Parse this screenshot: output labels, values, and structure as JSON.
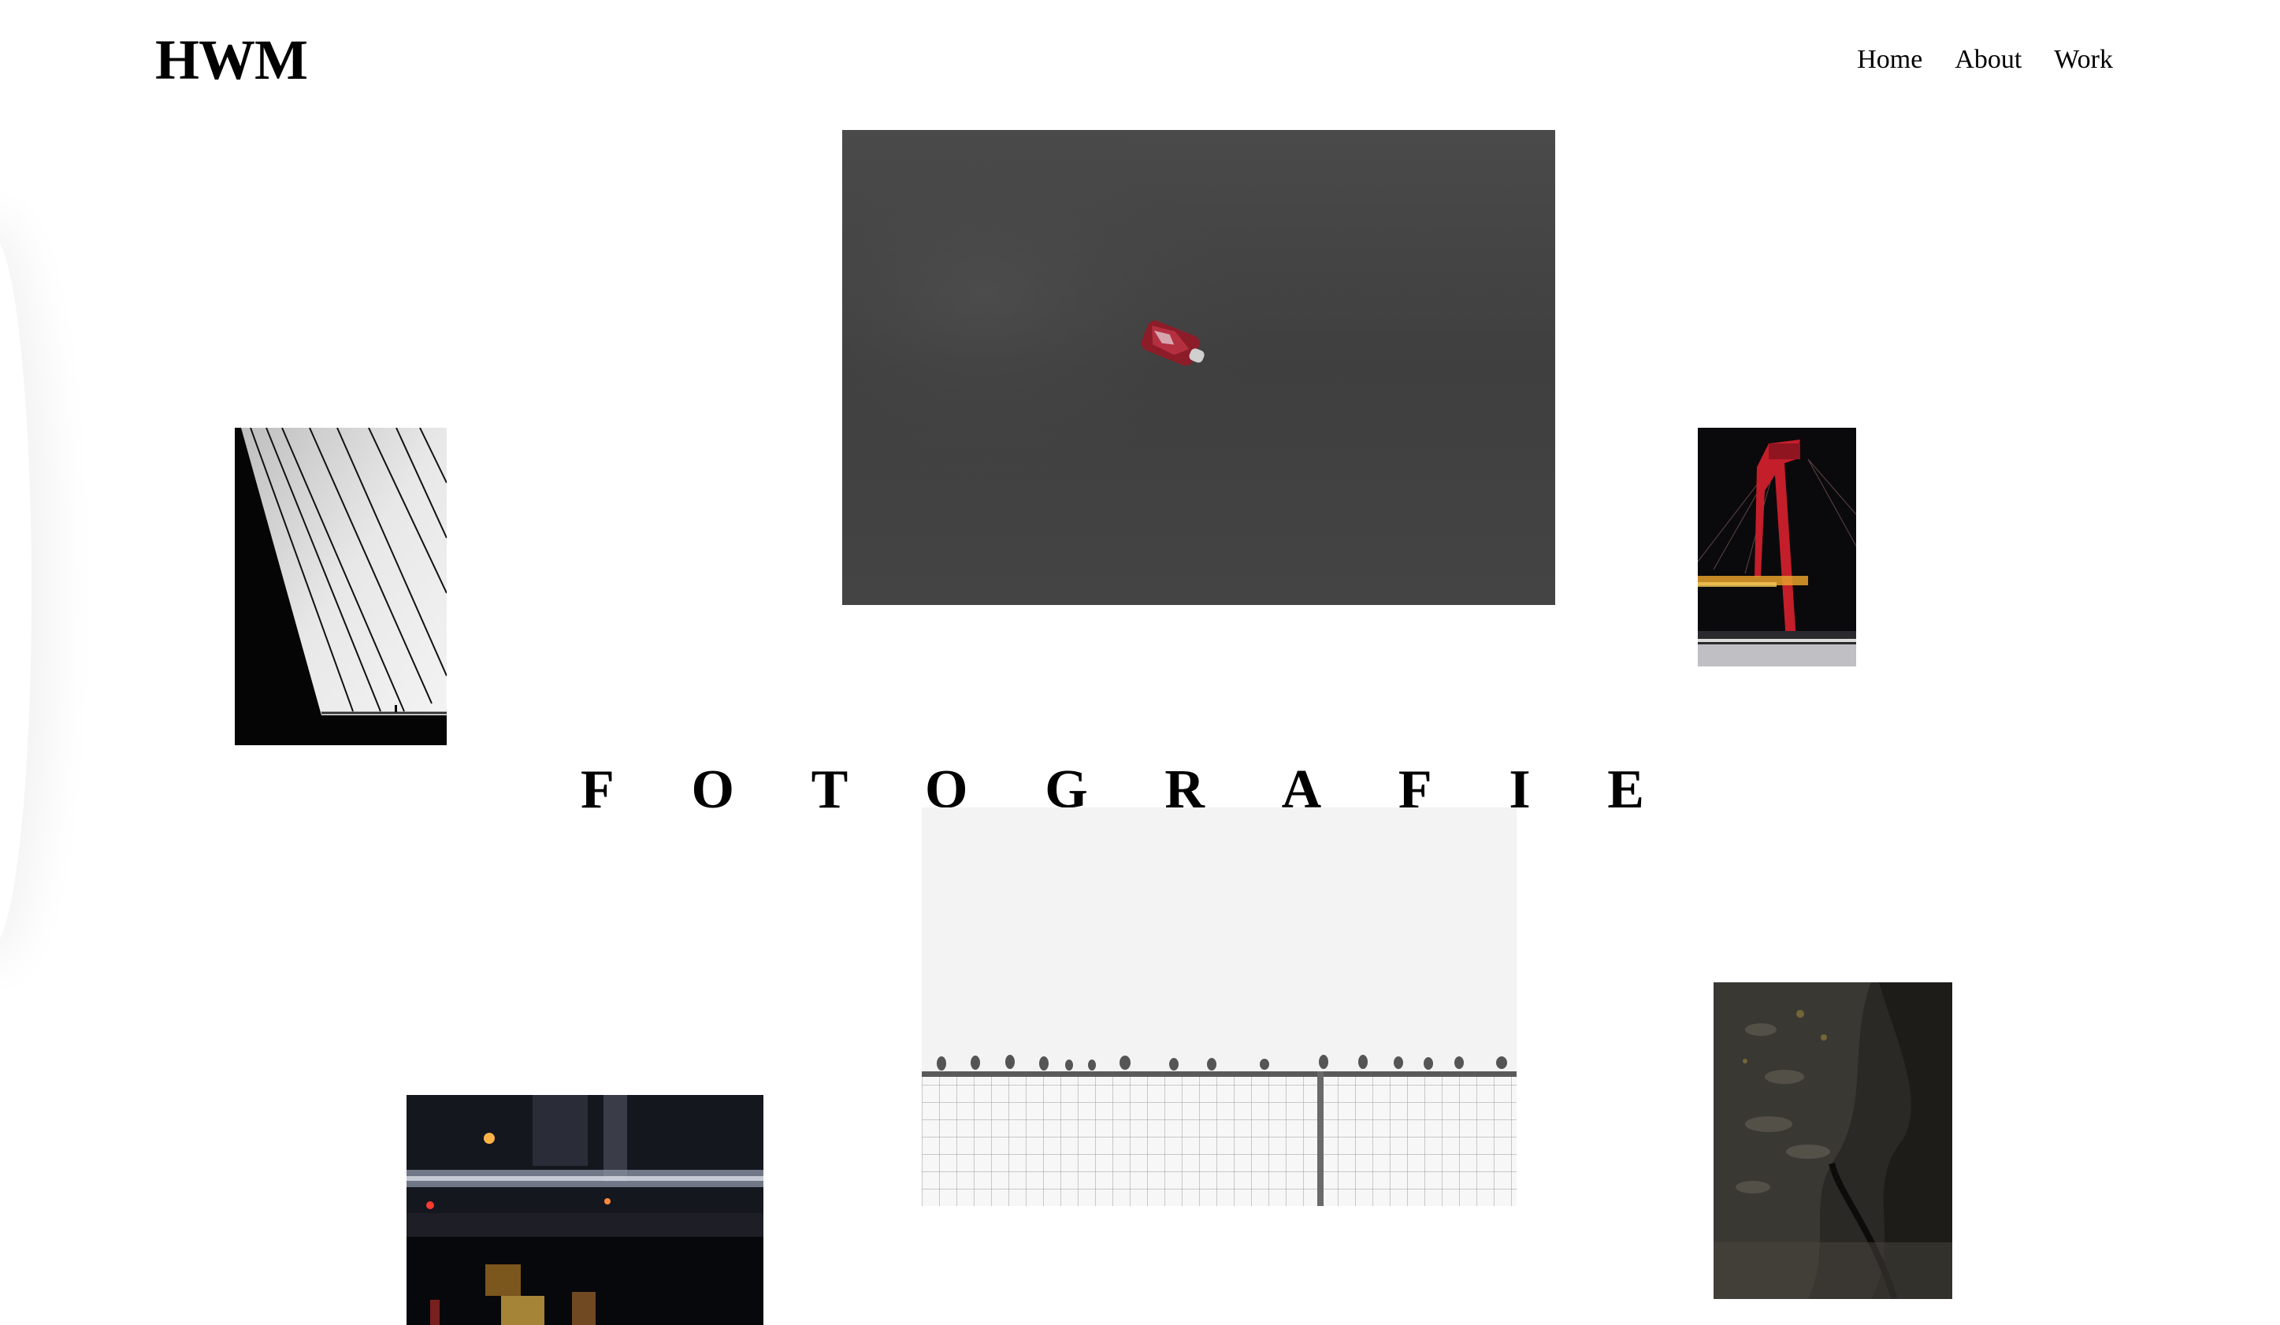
{
  "header": {
    "logo": "HWM",
    "nav": [
      "Home",
      "About",
      "Work"
    ]
  },
  "headline": {
    "letters": [
      "F",
      "O",
      "T",
      "O",
      "G",
      "R",
      "A",
      "F",
      "I",
      "E"
    ]
  },
  "colors": {
    "background": "#ffffff",
    "text": "#000000"
  }
}
